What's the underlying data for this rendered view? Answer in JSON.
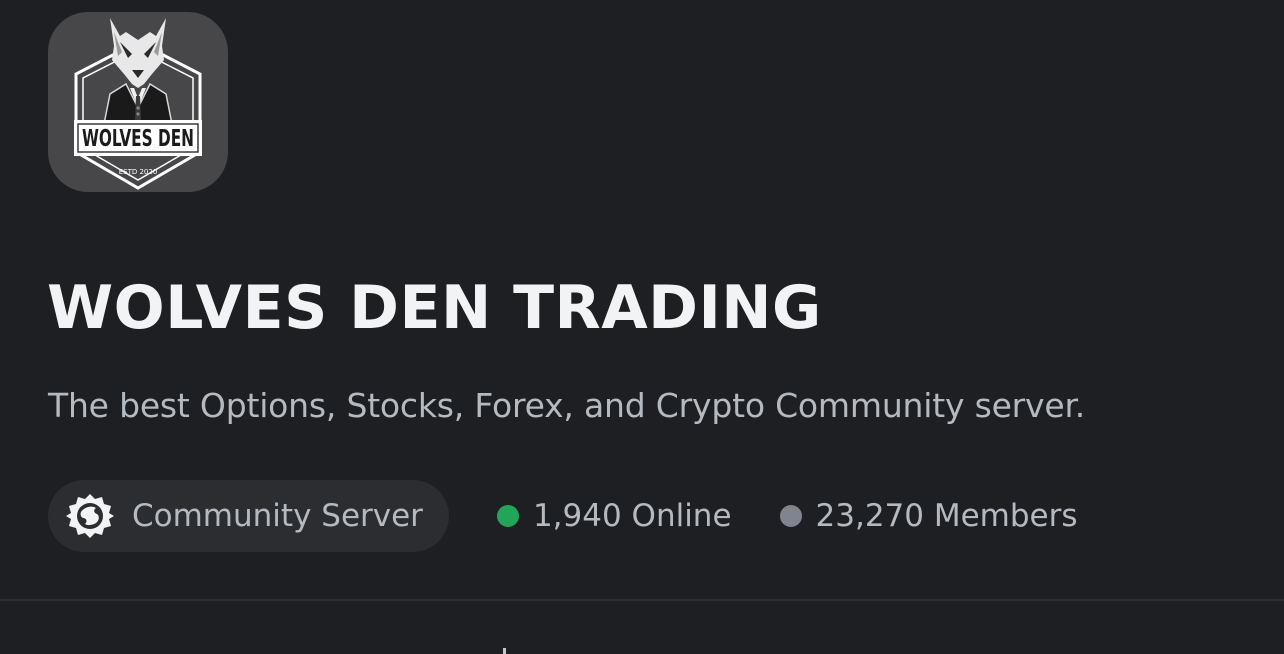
{
  "server": {
    "logo_text": "WOLVES DEN",
    "logo_subtext": "ESTD 2020",
    "name": "WOLVES DEN TRADING",
    "description": "The best Options, Stocks, Forex, and Crypto Community server."
  },
  "badges": {
    "community_label": "Community Server",
    "community_icon": "community-server-icon"
  },
  "stats": {
    "online": "1,940 Online",
    "members": "23,270 Members"
  },
  "colors": {
    "background": "#1e1f22",
    "online_dot": "#23a559",
    "members_dot": "#80848e",
    "pill_background": "#2b2d31"
  }
}
